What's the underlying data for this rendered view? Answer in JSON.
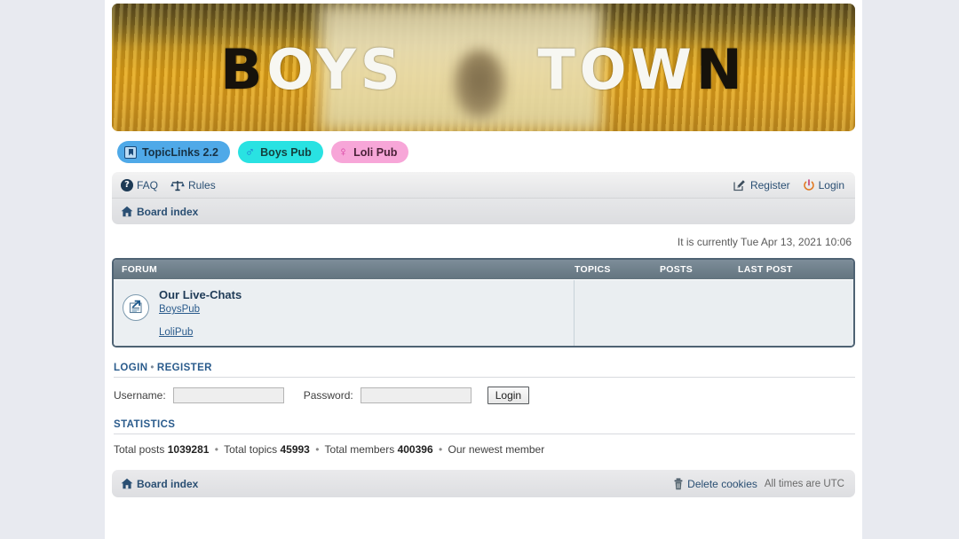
{
  "banner": {
    "word1": "BOYS",
    "word2": "TOWN",
    "alt": "boys-town-banner"
  },
  "pills": [
    {
      "label": "TopicLinks 2.2",
      "icon": "bookmark-icon",
      "color": "#4fa9e8"
    },
    {
      "label": "Boys Pub",
      "icon": "mars-symbol-icon",
      "glyph": "♂",
      "color": "#29e2e2"
    },
    {
      "label": "Loli Pub",
      "icon": "venus-symbol-icon",
      "glyph": "♀",
      "color": "#f7a6d8"
    }
  ],
  "navbar": {
    "left": [
      {
        "label": "FAQ",
        "icon": "question-circle-icon"
      },
      {
        "label": "Rules",
        "icon": "scales-icon"
      }
    ],
    "right": [
      {
        "label": "Register",
        "icon": "pencil-icon"
      },
      {
        "label": "Login",
        "icon": "power-icon"
      }
    ],
    "board_index": "Board index",
    "board_index_icon": "home-icon"
  },
  "current_time": "It is currently Tue Apr 13, 2021 10:06",
  "forum_table": {
    "columns": [
      "FORUM",
      "TOPICS",
      "POSTS",
      "LAST POST"
    ],
    "rows": [
      {
        "icon": "external-link-forum-icon",
        "title": "Our Live-Chats",
        "links": [
          "BoysPub",
          "LoliPub"
        ],
        "topics": "",
        "posts": "",
        "last_post": ""
      }
    ]
  },
  "login_section": {
    "heading_login": "LOGIN",
    "heading_sep": "•",
    "heading_register": "REGISTER",
    "username_label": "Username:",
    "username_value": "",
    "password_label": "Password:",
    "password_value": "",
    "submit_label": "Login"
  },
  "statistics": {
    "heading": "STATISTICS",
    "total_posts_label": "Total posts",
    "total_posts": "1039281",
    "total_topics_label": "Total topics",
    "total_topics": "45993",
    "total_members_label": "Total members",
    "total_members": "400396",
    "newest_member_label": "Our newest member",
    "separator": "•"
  },
  "footer": {
    "board_index": "Board index",
    "board_index_icon": "home-icon",
    "delete_cookies": "Delete cookies",
    "delete_cookies_icon": "trash-icon",
    "timezone": "All times are UTC"
  }
}
